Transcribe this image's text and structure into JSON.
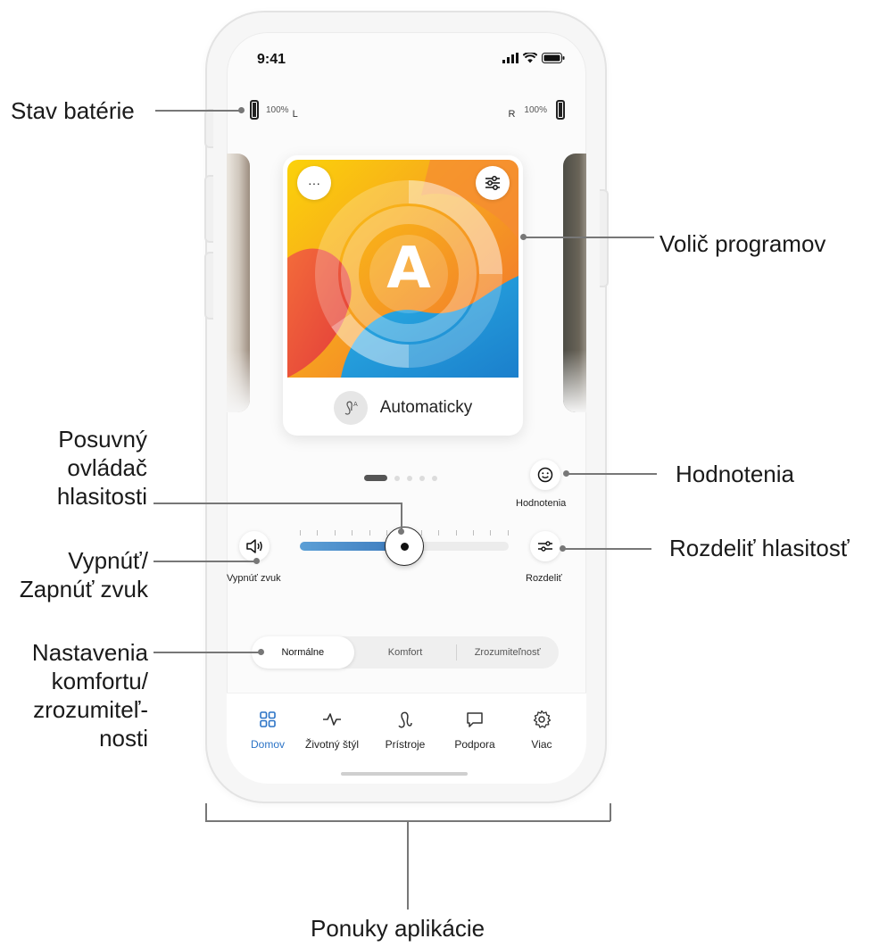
{
  "status_bar": {
    "time": "9:41"
  },
  "battery": {
    "left": {
      "percent": "100%",
      "side": "L"
    },
    "right": {
      "percent": "100%",
      "side": "R"
    }
  },
  "program": {
    "letter": "A",
    "name": "Automaticky",
    "more_icon": "more-icon",
    "settings_icon": "sliders-icon",
    "colors": {
      "yellow": "#f9c90b",
      "orange": "#f37e2f",
      "red": "#e84d3a",
      "blue": "#1e9bd8"
    }
  },
  "carousel": {
    "pages": 5,
    "active_page": 1
  },
  "volume": {
    "level": 0.5,
    "mute_label": "Vypnúť zvuk",
    "split_label": "Rozdeliť",
    "rating_label": "Hodnotenia"
  },
  "comfort": {
    "options": [
      "Normálne",
      "Komfort",
      "Zrozumiteľnosť"
    ],
    "selected": "Normálne"
  },
  "tabs": [
    {
      "label": "Domov",
      "icon": "grid-icon",
      "active": true
    },
    {
      "label": "Životný štýl",
      "icon": "activity-icon",
      "active": false
    },
    {
      "label": "Prístroje",
      "icon": "hearing-aid-icon",
      "active": false
    },
    {
      "label": "Podpora",
      "icon": "chat-icon",
      "active": false
    },
    {
      "label": "Viac",
      "icon": "gear-icon",
      "active": false
    }
  ],
  "accent_color": "#2b73c6",
  "callouts": {
    "battery": "Stav batérie",
    "program_selector": "Volič programov",
    "volume_slider": [
      "Posuvný",
      "ovládač",
      "hlasitosti"
    ],
    "ratings": "Hodnotenia",
    "mute": [
      "Vypnúť/",
      "Zapnúť zvuk"
    ],
    "split": "Rozdeliť hlasitosť",
    "comfort": [
      "Nastavenia",
      "komfortu/",
      "zrozumiteľ-",
      "nosti"
    ],
    "menus": "Ponuky aplikácie"
  }
}
